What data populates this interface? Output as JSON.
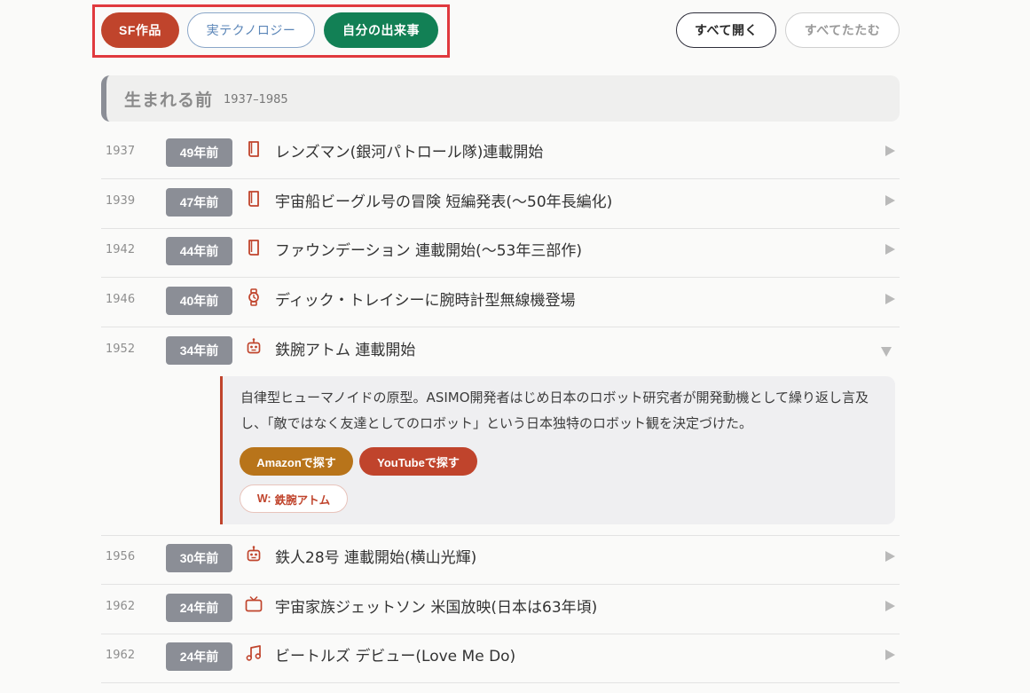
{
  "filters": {
    "sf": "SF作品",
    "tech": "実テクノロジー",
    "self": "自分の出来事"
  },
  "toolbar": {
    "open_all": "すべて開く",
    "close_all": "すべてたたむ"
  },
  "era": {
    "title": "生まれる前",
    "range": "1937–1985"
  },
  "events": [
    {
      "year": "1937",
      "ago": "49年前",
      "icon": "book-icon",
      "title": "レンズマン(銀河パトロール隊)連載開始"
    },
    {
      "year": "1939",
      "ago": "47年前",
      "icon": "book-icon",
      "title": "宇宙船ビーグル号の冒険 短編発表(〜50年長編化)"
    },
    {
      "year": "1942",
      "ago": "44年前",
      "icon": "book-icon",
      "title": "ファウンデーション 連載開始(〜53年三部作)"
    },
    {
      "year": "1946",
      "ago": "40年前",
      "icon": "watch-icon",
      "title": "ディック・トレイシーに腕時計型無線機登場"
    },
    {
      "year": "1952",
      "ago": "34年前",
      "icon": "robot-icon",
      "title": "鉄腕アトム 連載開始"
    },
    {
      "year": "1956",
      "ago": "30年前",
      "icon": "robot-icon",
      "title": "鉄人28号 連載開始(横山光輝)"
    },
    {
      "year": "1962",
      "ago": "24年前",
      "icon": "tv-icon",
      "title": "宇宙家族ジェットソン 米国放映(日本は63年頃)"
    },
    {
      "year": "1962",
      "ago": "24年前",
      "icon": "music-icon",
      "title": "ビートルズ デビュー(Love Me Do)"
    }
  ],
  "detail": {
    "description": "自律型ヒューマノイドの原型。ASIMO開発者はじめ日本のロボット研究者が開発動機として繰り返し言及し、「敵ではなく友達としてのロボット」という日本独特のロボット観を決定づけた。",
    "amazon_label": "Amazonで探す",
    "youtube_label": "YouTubeで探す",
    "wiki_prefix": "W:",
    "wiki_label": "鉄腕アトム"
  },
  "colors": {
    "accent_red": "#c0442c",
    "accent_green": "#128055",
    "accent_blue": "#5b86b8",
    "amazon": "#b8741a",
    "badge_gray": "#8b8e96"
  }
}
